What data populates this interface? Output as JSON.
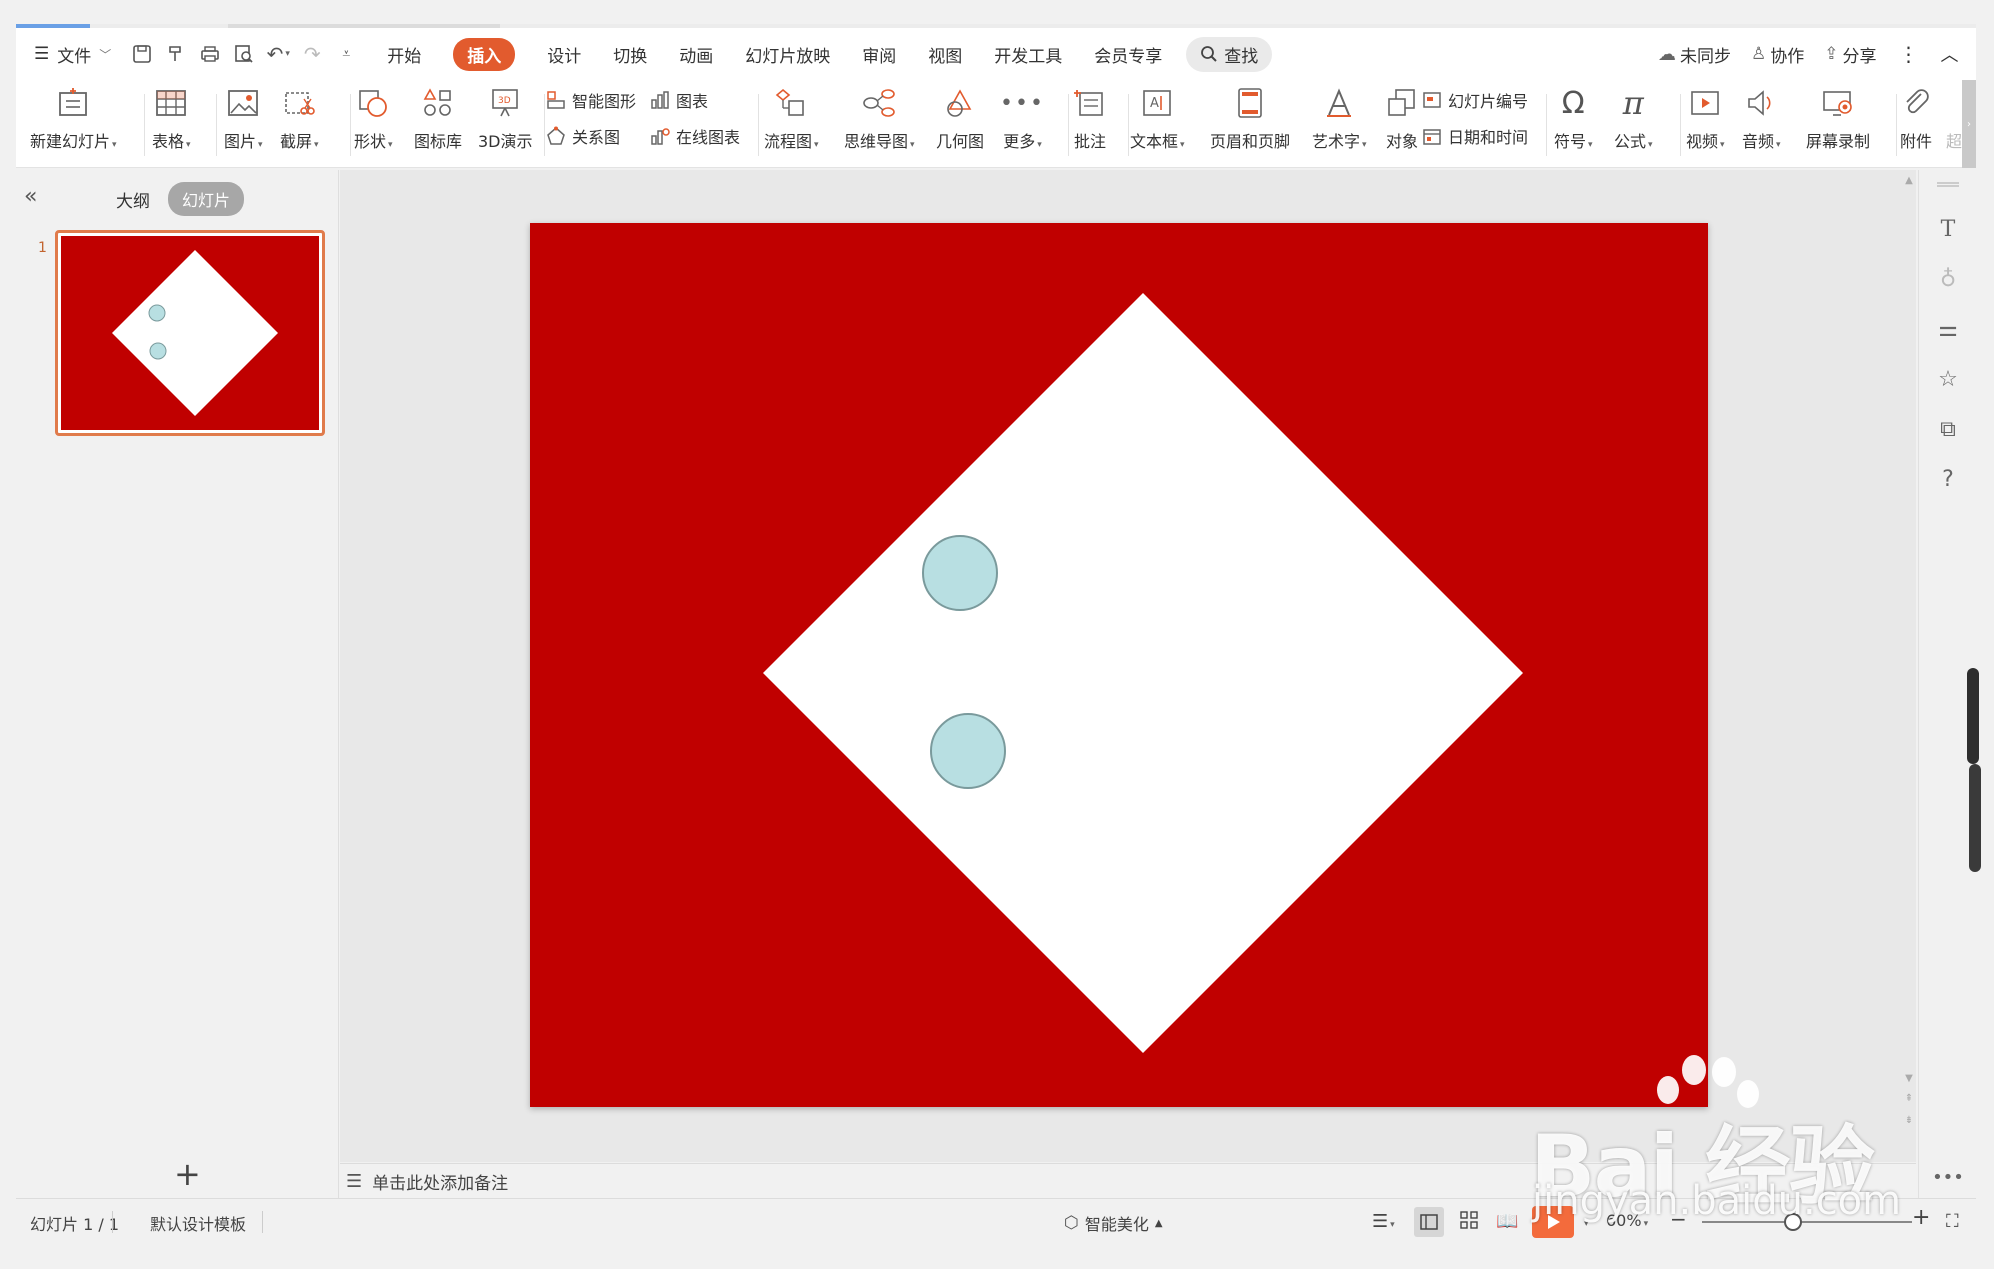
{
  "menu": {
    "file_label": "文件",
    "tabs": [
      "开始",
      "插入",
      "设计",
      "切换",
      "动画",
      "幻灯片放映",
      "审阅",
      "视图",
      "开发工具",
      "会员专享"
    ],
    "active_tab": "插入",
    "search_label": "查找",
    "right": {
      "sync": "未同步",
      "collab": "协作",
      "share": "分享"
    }
  },
  "ribbon": {
    "new_slide": "新建幻灯片",
    "table": "表格",
    "picture": "图片",
    "screenshot": "截屏",
    "shape": "形状",
    "icon_lib": "图标库",
    "demo3d": "3D演示",
    "smart_art": "智能图形",
    "chart": "图表",
    "relation": "关系图",
    "online_chart": "在线图表",
    "flowchart": "流程图",
    "mindmap": "思维导图",
    "geometry": "几何图",
    "more": "更多",
    "comment": "批注",
    "textbox": "文本框",
    "header_footer": "页眉和页脚",
    "wordart": "艺术字",
    "object": "对象",
    "slide_number": "幻灯片编号",
    "datetime": "日期和时间",
    "symbol": "符号",
    "formula": "公式",
    "video": "视频",
    "audio": "音频",
    "screen_record": "屏幕录制",
    "attachment": "附件",
    "hyperlink_cut": "超"
  },
  "left_panel": {
    "tab_outline": "大纲",
    "tab_slides": "幻灯片",
    "thumb_number": "1"
  },
  "notes": {
    "placeholder": "单击此处添加备注"
  },
  "status": {
    "slide_count": "幻灯片 1 / 1",
    "template": "默认设计模板",
    "beautify": "智能美化",
    "zoom": "60%"
  },
  "slide": {
    "background_color": "#c00000",
    "diamond_color": "#ffffff",
    "circle_fill": "#b8dfe2",
    "circle_stroke": "#7a9a9c"
  },
  "colors": {
    "accent": "#e25b2e",
    "thumb_border": "#e07b4b"
  },
  "watermark": {
    "brand": "Bai 经验",
    "url": "jingyan.baidu.com"
  }
}
